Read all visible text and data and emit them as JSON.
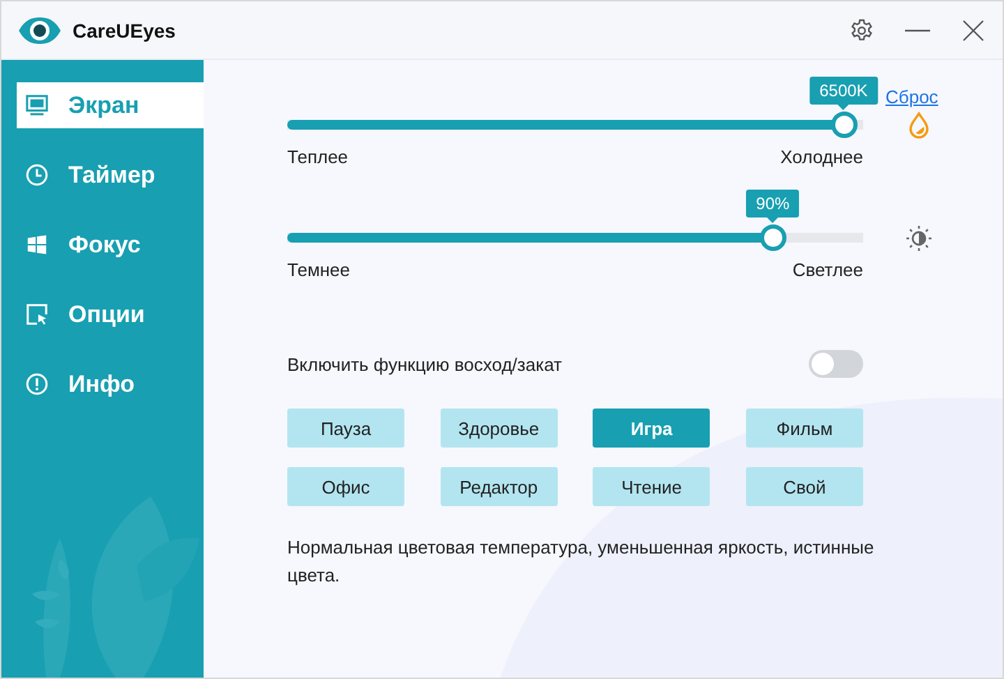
{
  "window": {
    "title": "CareUEyes"
  },
  "sidebar": {
    "items": [
      {
        "label": "Экран",
        "kind": "screen",
        "selected": true
      },
      {
        "label": "Таймер",
        "kind": "timer",
        "selected": false
      },
      {
        "label": "Фокус",
        "kind": "focus",
        "selected": false
      },
      {
        "label": "Опции",
        "kind": "options",
        "selected": false
      },
      {
        "label": "Инфо",
        "kind": "info",
        "selected": false
      }
    ]
  },
  "sliders": [
    {
      "kind": "temperature",
      "level": 0.966,
      "reading": "6500K",
      "left_label": "Теплее",
      "right_label": "Холоднее",
      "reset_link": "Сброс"
    },
    {
      "kind": "brightness",
      "level": 0.843,
      "reading": "90%",
      "left_label": "Темнее",
      "right_label": "Светлее"
    }
  ],
  "sunrise_toggle": {
    "label": "Включить функцию восход/закат",
    "on": false
  },
  "presets": [
    {
      "label": "Пауза",
      "selected": false
    },
    {
      "label": "Здоровье",
      "selected": false
    },
    {
      "label": "Игра",
      "selected": true
    },
    {
      "label": "Фильм",
      "selected": false
    },
    {
      "label": "Офис",
      "selected": false
    },
    {
      "label": "Редактор",
      "selected": false
    },
    {
      "label": "Чтение",
      "selected": false
    },
    {
      "label": "Свой",
      "selected": false
    }
  ],
  "description": "Нормальная цветовая температура, уменьшенная яркость, истинные цвета."
}
